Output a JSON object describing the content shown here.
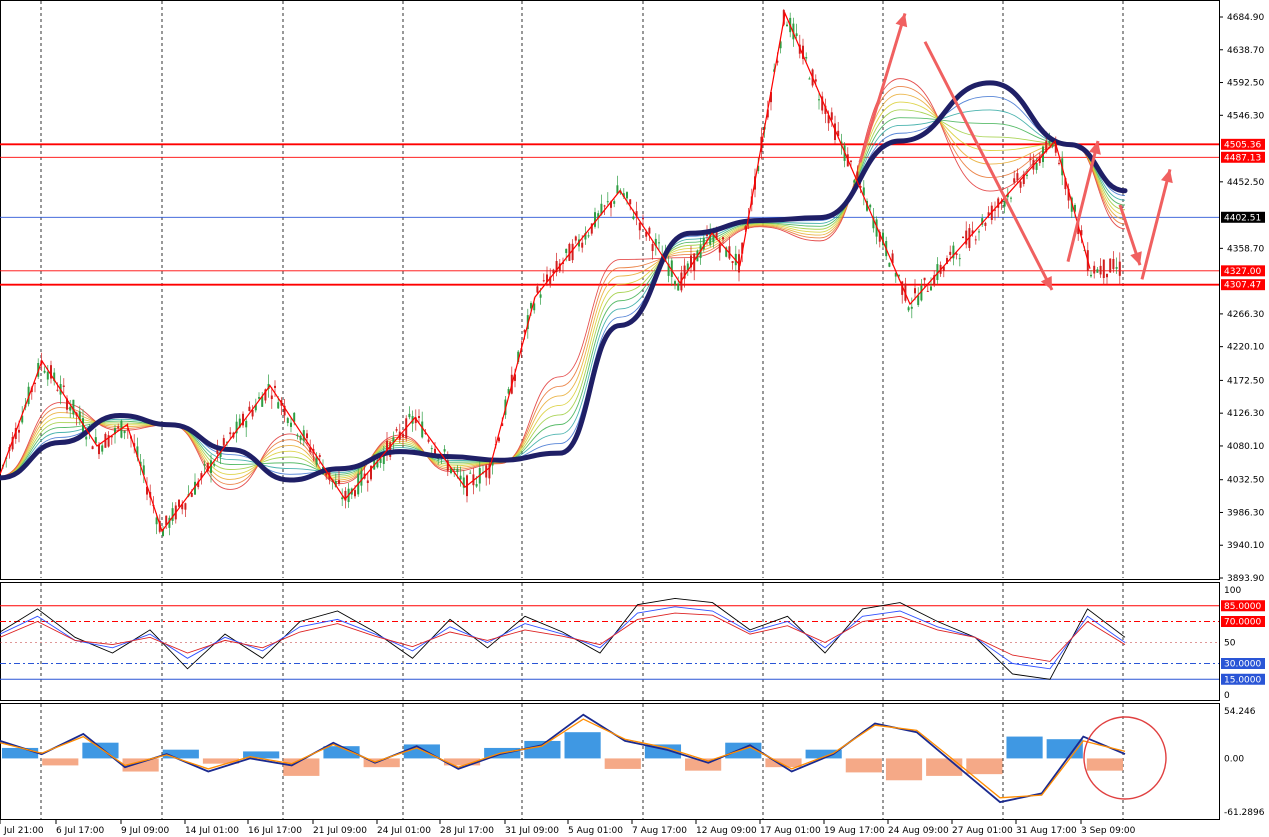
{
  "colors": {
    "bull": "#2e9e43",
    "bear": "#d21f1f",
    "wick": "#4a6b4a",
    "ma_thick": "#1f1f66",
    "level_red": "#ff0000",
    "level_blue": "#2a55d6",
    "arrow": "#f06060",
    "hist_pos": "#2a8de0",
    "hist_neg": "#f4a07a",
    "macd": "#1b2a8f",
    "signal": "#ff8c00",
    "stoch_k": "#000000",
    "stoch_mid": "#3050ff",
    "stoch_d": "#dd2222",
    "grid": "#000000"
  },
  "chart_data": [
    {
      "type": "candlestick",
      "price_axis_ticks": [
        "4684.90",
        "4638.70",
        "4592.50",
        "4546.30",
        "4452.50",
        "4358.70",
        "4266.30",
        "4220.10",
        "4172.50",
        "4126.30",
        "4080.10",
        "4032.50",
        "3986.30",
        "3940.10",
        "3893.90"
      ],
      "ylim": [
        3893.9,
        4684.9
      ],
      "horizontal_levels": [
        {
          "label": "4505.36",
          "value": 4505.36,
          "color": "red"
        },
        {
          "label": "4487.13",
          "value": 4487.13,
          "color": "red"
        },
        {
          "label": "4402.51",
          "value": 4402.51,
          "color": "blue"
        },
        {
          "label": "4327.00",
          "value": 4327.0,
          "color": "red"
        },
        {
          "label": "4307.47",
          "value": 4307.47,
          "color": "red"
        }
      ],
      "zigzag_values": [
        4040,
        4200,
        4080,
        4110,
        3960,
        4165,
        4005,
        4120,
        4022,
        4050,
        4290,
        4440,
        4310,
        4380,
        4335,
        4690,
        4280,
        4510,
        4330
      ],
      "forecast_arrows": [
        {
          "from_value": 4420,
          "to_value": 4335,
          "direction": "down"
        },
        {
          "from_value": 4335,
          "to_value": 4470,
          "direction": "up"
        }
      ],
      "thick_ma_values": [
        4035,
        4085,
        4123,
        4110,
        4075,
        4032,
        4048,
        4072,
        4065,
        4060,
        4070,
        4250,
        4380,
        4398,
        4402,
        4510,
        4592,
        4505,
        4440
      ]
    },
    {
      "type": "line",
      "name": "oscillator",
      "axis_ticks": [
        "100",
        "50",
        "0"
      ],
      "ylim": [
        0,
        100
      ],
      "levels": [
        {
          "label": "85.0000",
          "value": 85
        },
        {
          "label": "70.0000",
          "value": 70
        },
        {
          "label": "30.0000",
          "value": 30
        },
        {
          "label": "15.0000",
          "value": 15
        }
      ],
      "series": [
        {
          "values": [
            60,
            82,
            55,
            40,
            62,
            25,
            58,
            35,
            70,
            80,
            60,
            35,
            72,
            45,
            75,
            60,
            40,
            86,
            92,
            88,
            62,
            75,
            40,
            82,
            88,
            70,
            55,
            20,
            15,
            82,
            55
          ]
        },
        {
          "values": [
            58,
            75,
            52,
            45,
            58,
            35,
            55,
            42,
            65,
            72,
            58,
            42,
            65,
            50,
            68,
            58,
            45,
            78,
            84,
            80,
            60,
            70,
            45,
            75,
            80,
            65,
            55,
            30,
            25,
            75,
            50
          ]
        },
        {
          "values": [
            55,
            70,
            52,
            48,
            55,
            40,
            52,
            45,
            60,
            68,
            56,
            46,
            60,
            52,
            62,
            56,
            48,
            72,
            78,
            76,
            58,
            66,
            50,
            70,
            75,
            62,
            55,
            38,
            32,
            70,
            48
          ]
        }
      ]
    },
    {
      "type": "bar",
      "name": "histogram",
      "axis_ticks": [
        "54.246",
        "0.00",
        "-61.2896"
      ],
      "ylim": [
        -61.2896,
        54.246
      ],
      "values": [
        12,
        -8,
        18,
        -15,
        10,
        -6,
        8,
        -20,
        14,
        -10,
        16,
        -8,
        12,
        20,
        30,
        -12,
        16,
        -14,
        18,
        -10,
        10,
        -16,
        -25,
        -20,
        -18,
        25,
        22,
        -14
      ],
      "series": [
        {
          "values": [
            20,
            5,
            28,
            -10,
            5,
            -15,
            0,
            -8,
            18,
            -5,
            14,
            -12,
            5,
            15,
            50,
            20,
            10,
            -5,
            15,
            -15,
            5,
            40,
            30,
            -10,
            -50,
            -40,
            25,
            5
          ]
        },
        {
          "values": [
            18,
            6,
            25,
            -8,
            4,
            -12,
            2,
            -6,
            16,
            -4,
            12,
            -10,
            6,
            14,
            45,
            22,
            12,
            -3,
            13,
            -12,
            6,
            38,
            32,
            -6,
            -45,
            -42,
            20,
            8
          ]
        }
      ]
    }
  ],
  "x_axis": {
    "labels": [
      "Jul 21:00",
      "6 Jul 17:00",
      "9 Jul 09:00",
      "14 Jul 01:00",
      "16 Jul 17:00",
      "21 Jul 09:00",
      "24 Jul 01:00",
      "28 Jul 17:00",
      "31 Jul 09:00",
      "5 Aug 01:00",
      "7 Aug 17:00",
      "12 Aug 09:00",
      "17 Aug 01:00",
      "19 Aug 17:00",
      "24 Aug 09:00",
      "27 Aug 01:00",
      "31 Aug 17:00",
      "3 Sep 09:00"
    ]
  }
}
